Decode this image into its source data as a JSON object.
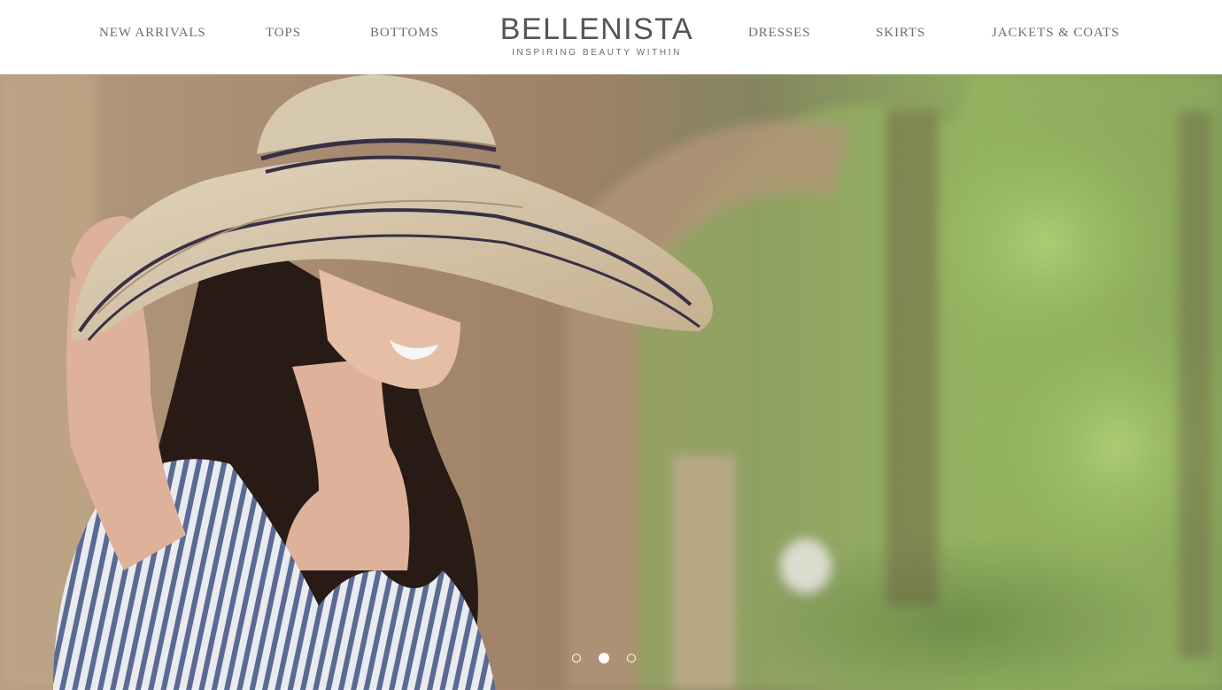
{
  "nav": {
    "left_items": [
      "NEW ARRIVALS",
      "TOPS",
      "BOTTOMS"
    ],
    "right_items": [
      "DRESSES",
      "SKIRTS",
      "JACKETS & COATS"
    ]
  },
  "logo": {
    "title": "BELLENISTA",
    "tagline": "INSPIRING BEAUTY WITHIN"
  },
  "hero": {
    "image": "woman-in-straw-hat-photo",
    "slide_count": 3,
    "active_slide": 2
  },
  "colors": {
    "nav_text": "#6e6e6e",
    "logo_text": "#555555",
    "background": "#ffffff"
  }
}
